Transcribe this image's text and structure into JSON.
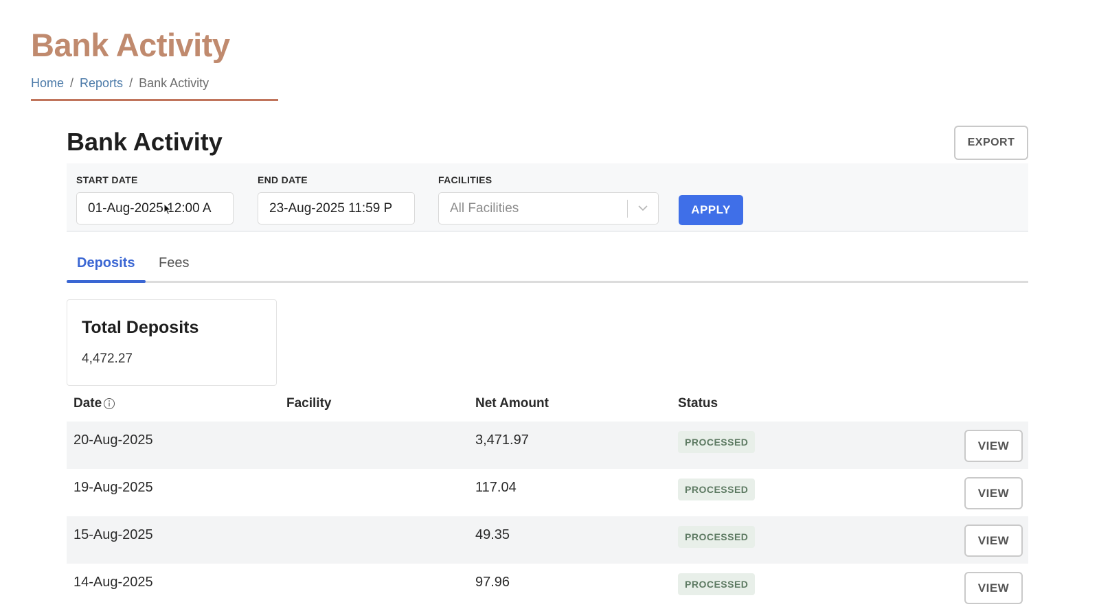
{
  "page": {
    "title": "Bank Activity",
    "breadcrumb": [
      "Home",
      "Reports",
      "Bank Activity"
    ]
  },
  "card": {
    "title": "Bank Activity",
    "export_label": "EXPORT"
  },
  "filters": {
    "start_date": {
      "label": "START DATE",
      "value": "01-Aug-2025 12:00 A"
    },
    "end_date": {
      "label": "END DATE",
      "value": "23-Aug-2025 11:59 P"
    },
    "facilities": {
      "label": "FACILITIES",
      "placeholder": "All Facilities"
    },
    "apply_label": "APPLY"
  },
  "tabs": [
    {
      "label": "Deposits",
      "active": true
    },
    {
      "label": "Fees",
      "active": false
    }
  ],
  "summary": {
    "title": "Total Deposits",
    "value": "4,472.27"
  },
  "table": {
    "columns": [
      "Date",
      "Facility",
      "Net Amount",
      "Status"
    ],
    "rows": [
      {
        "date": "20-Aug-2025",
        "facility": "",
        "net_amount": "3,471.97",
        "status": "PROCESSED",
        "action": "VIEW"
      },
      {
        "date": "19-Aug-2025",
        "facility": "",
        "net_amount": "117.04",
        "status": "PROCESSED",
        "action": "VIEW"
      },
      {
        "date": "15-Aug-2025",
        "facility": "",
        "net_amount": "49.35",
        "status": "PROCESSED",
        "action": "VIEW"
      },
      {
        "date": "14-Aug-2025",
        "facility": "",
        "net_amount": "97.96",
        "status": "PROCESSED",
        "action": "VIEW"
      }
    ]
  },
  "colors": {
    "page_title": "#c08a6e",
    "accent": "#3f6fe8",
    "breadcrumb_underline": "#c0745b",
    "status_badge_bg": "#e8efe9"
  },
  "icons": {
    "date_info": "info-icon",
    "facilities_dropdown": "chevron-down-icon",
    "cursor": "mouse-cursor-icon"
  }
}
